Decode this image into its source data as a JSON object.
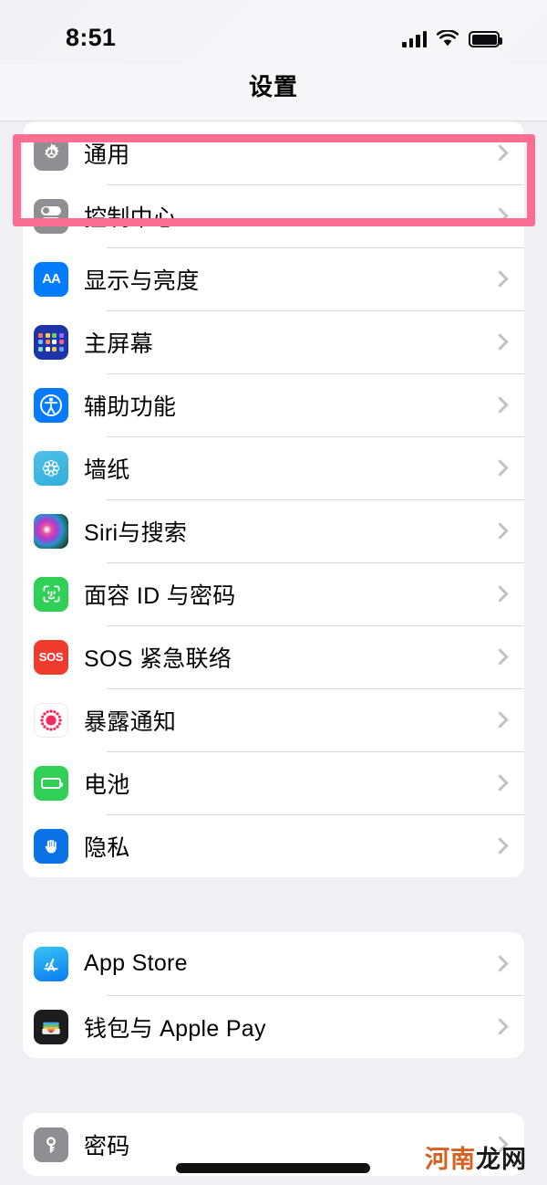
{
  "status_bar": {
    "time": "8:51",
    "signal_icon": "cellular-signal-icon",
    "wifi_icon": "wifi-icon",
    "battery_icon": "battery-full-icon"
  },
  "header": {
    "title": "设置"
  },
  "highlight": {
    "color": "#FA6E91",
    "target": "通用"
  },
  "groups": [
    {
      "rows": [
        {
          "label": "通用",
          "icon": "settings-gear-icon",
          "chevron": "chevron-right-icon"
        },
        {
          "label": "控制中心",
          "icon": "control-center-icon",
          "chevron": "chevron-right-icon"
        },
        {
          "label": "显示与亮度",
          "icon": "display-brightness-icon",
          "chevron": "chevron-right-icon"
        },
        {
          "label": "主屏幕",
          "icon": "home-screen-icon",
          "chevron": "chevron-right-icon"
        },
        {
          "label": "辅助功能",
          "icon": "accessibility-icon",
          "chevron": "chevron-right-icon"
        },
        {
          "label": "墙纸",
          "icon": "wallpaper-icon",
          "chevron": "chevron-right-icon"
        },
        {
          "label": "Siri与搜索",
          "icon": "siri-icon",
          "chevron": "chevron-right-icon"
        },
        {
          "label": "面容 ID 与密码",
          "icon": "face-id-icon",
          "chevron": "chevron-right-icon"
        },
        {
          "label": "SOS 紧急联络",
          "icon": "emergency-sos-icon",
          "chevron": "chevron-right-icon"
        },
        {
          "label": "暴露通知",
          "icon": "exposure-notification-icon",
          "chevron": "chevron-right-icon"
        },
        {
          "label": "电池",
          "icon": "battery-icon",
          "chevron": "chevron-right-icon"
        },
        {
          "label": "隐私",
          "icon": "privacy-hand-icon",
          "chevron": "chevron-right-icon"
        }
      ]
    },
    {
      "rows": [
        {
          "label": "App Store",
          "icon": "app-store-icon",
          "chevron": "chevron-right-icon"
        },
        {
          "label": "钱包与 Apple Pay",
          "icon": "wallet-icon",
          "chevron": "chevron-right-icon"
        }
      ]
    },
    {
      "rows": [
        {
          "label": "密码",
          "icon": "passwords-key-icon",
          "chevron": "chevron-right-icon"
        }
      ]
    }
  ],
  "watermark": {
    "part_orange": "河南",
    "part_dark": "龙网",
    "orange_color": "#D9601F"
  },
  "icon_labels": {
    "aa": "AA",
    "sos": "SOS"
  }
}
